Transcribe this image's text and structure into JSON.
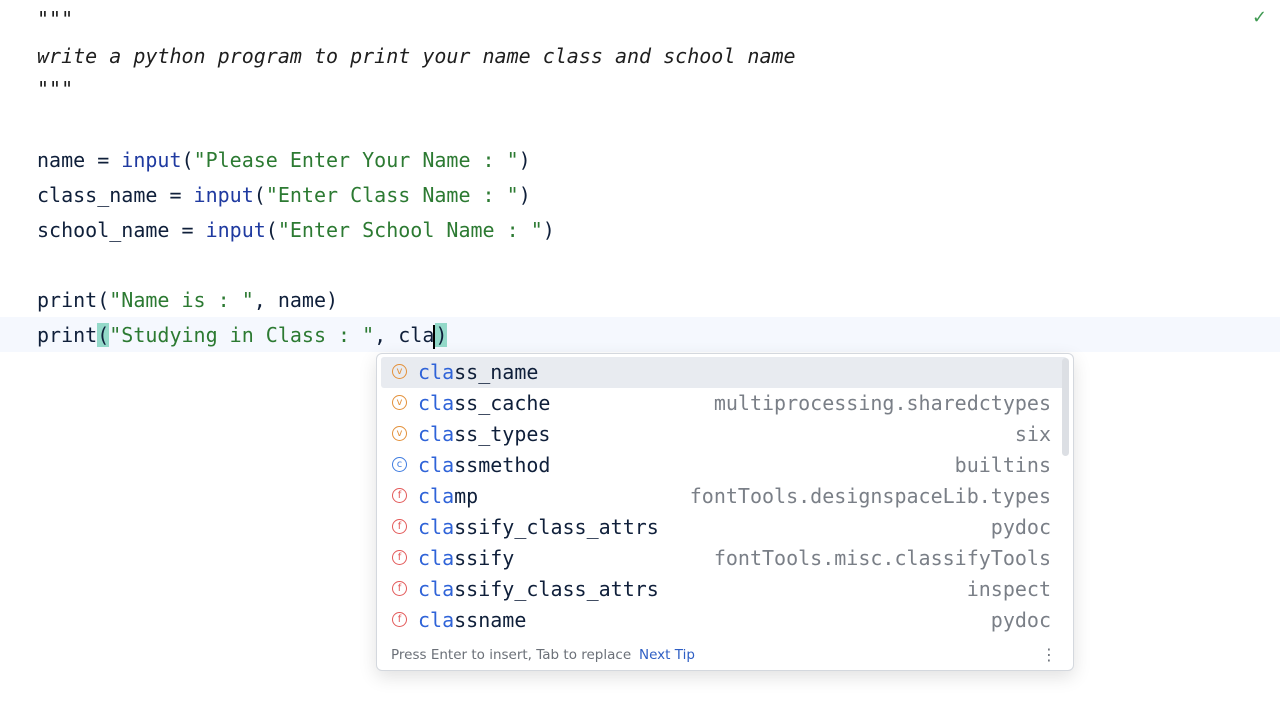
{
  "editor": {
    "doc_open": "\"\"\"",
    "doc_text": "write a python program to print your name class and school name",
    "doc_close": "\"\"\"",
    "line_name": {
      "var": "name = ",
      "fn": "input",
      "open": "(",
      "str": "\"Please Enter Your Name : \"",
      "close": ")"
    },
    "line_class": {
      "var": "class_name = ",
      "fn": "input",
      "open": "(",
      "str": "\"Enter Class Name : \"",
      "close": ")"
    },
    "line_school": {
      "var": "school_name = ",
      "fn": "input",
      "open": "(",
      "str": "\"Enter School Name : \"",
      "close": ")"
    },
    "line_print1": {
      "fn": "print",
      "open": "(",
      "str": "\"Name is : \"",
      "rest": ", name)"
    },
    "line_print2": {
      "fn": "print",
      "open": "(",
      "str": "\"Studying in Class : \"",
      "rest": ", cla",
      "close": ")"
    }
  },
  "status": {
    "check_icon": "check-icon",
    "check_color": "#3f9a52"
  },
  "completion": {
    "typed_prefix": "cla",
    "items": [
      {
        "icon": "variable-icon",
        "kind": "v",
        "prefix": "cla",
        "suffix": "ss_name",
        "source": ""
      },
      {
        "icon": "variable-icon",
        "kind": "v",
        "prefix": "cla",
        "suffix": "ss_cache",
        "source": "multiprocessing.sharedctypes"
      },
      {
        "icon": "variable-icon",
        "kind": "v",
        "prefix": "cla",
        "suffix": "ss_types",
        "source": "six"
      },
      {
        "icon": "class-icon",
        "kind": "c",
        "prefix": "cla",
        "suffix": "ssmethod",
        "source": "builtins"
      },
      {
        "icon": "function-icon",
        "kind": "f",
        "prefix": "cla",
        "suffix": "mp",
        "source": "fontTools.designspaceLib.types"
      },
      {
        "icon": "function-icon",
        "kind": "f",
        "prefix": "cla",
        "suffix": "ssify_class_attrs",
        "source": "pydoc"
      },
      {
        "icon": "function-icon",
        "kind": "f",
        "prefix": "cla",
        "suffix": "ssify",
        "source": "fontTools.misc.classifyTools"
      },
      {
        "icon": "function-icon",
        "kind": "f",
        "prefix": "cla",
        "suffix": "ssify_class_attrs",
        "source": "inspect"
      },
      {
        "icon": "function-icon",
        "kind": "f",
        "prefix": "cla",
        "suffix": "ssname",
        "source": "pydoc"
      }
    ],
    "icon_letters": {
      "v": "v",
      "c": "c",
      "f": "f"
    },
    "footer_hint": "Press Enter to insert, Tab to replace",
    "footer_tip": "Next Tip",
    "more_icon": "⋮"
  }
}
